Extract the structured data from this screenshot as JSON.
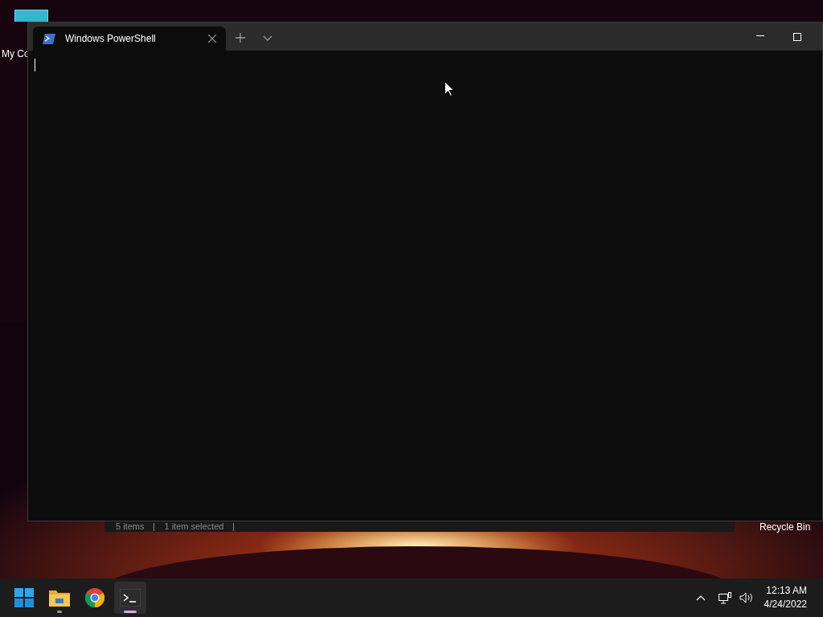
{
  "desktop_icons": [
    {
      "label": "My Co"
    },
    {
      "label": "Recycle Bin"
    }
  ],
  "background_window": {
    "status_items": [
      "5 items",
      "1 item selected"
    ]
  },
  "terminal": {
    "tabs": [
      {
        "title": "Windows PowerShell",
        "selected": true
      }
    ]
  },
  "taskbar": {
    "apps": [
      {
        "kind": "start",
        "running": false,
        "active": false
      },
      {
        "kind": "folder",
        "running": true,
        "active": false
      },
      {
        "kind": "browser",
        "running": false,
        "active": false
      },
      {
        "kind": "terminal",
        "running": true,
        "active": true
      }
    ],
    "time": "12:13 AM",
    "date": "4/24/2022"
  }
}
